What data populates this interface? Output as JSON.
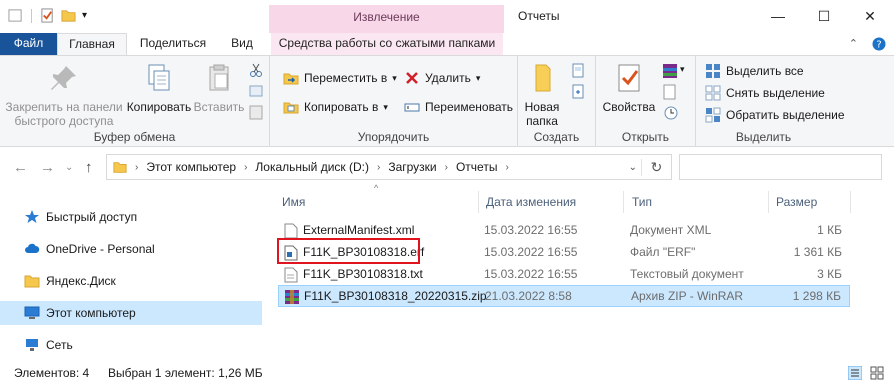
{
  "titlebar": {
    "context_tab_title": "Извлечение",
    "window_title": "Отчеты",
    "minimize": "—",
    "maximize": "☐",
    "close": "✕"
  },
  "tabs": {
    "file": "Файл",
    "home": "Главная",
    "share": "Поделиться",
    "view": "Вид",
    "context": "Средства работы со сжатыми папками"
  },
  "ribbon": {
    "clipboard": {
      "label": "Буфер обмена",
      "pin": "Закрепить на панели быстрого доступа",
      "copy": "Копировать",
      "paste": "Вставить"
    },
    "organize": {
      "label": "Упорядочить",
      "move": "Переместить в",
      "copy_to": "Копировать в",
      "delete": "Удалить",
      "rename": "Переименовать"
    },
    "create": {
      "label": "Создать",
      "new_folder": "Новая папка"
    },
    "open": {
      "label": "Открыть",
      "properties": "Свойства"
    },
    "select": {
      "label": "Выделить",
      "select_all": "Выделить все",
      "select_none": "Снять выделение",
      "invert": "Обратить выделение"
    }
  },
  "address": {
    "crumbs": [
      "Этот компьютер",
      "Локальный диск (D:)",
      "Загрузки",
      "Отчеты"
    ]
  },
  "navpane": {
    "items": [
      {
        "label": "Быстрый доступ",
        "icon": "star-icon"
      },
      {
        "label": "OneDrive - Personal",
        "icon": "cloud-icon"
      },
      {
        "label": "Яндекс.Диск",
        "icon": "folder-icon"
      },
      {
        "label": "Этот компьютер",
        "icon": "computer-icon",
        "selected": true
      },
      {
        "label": "Сеть",
        "icon": "network-icon"
      }
    ]
  },
  "columns": {
    "name": "Имя",
    "date": "Дата изменения",
    "type": "Тип",
    "size": "Размер"
  },
  "files": [
    {
      "name": "ExternalManifest.xml",
      "date": "15.03.2022 16:55",
      "type": "Документ XML",
      "size": "1 КБ",
      "icon": "xml-file-icon"
    },
    {
      "name": "F11K_BP30108318.erf",
      "date": "15.03.2022 16:55",
      "type": "Файл \"ERF\"",
      "size": "1 361 КБ",
      "icon": "erf-file-icon"
    },
    {
      "name": "F11K_BP30108318.txt",
      "date": "15.03.2022 16:55",
      "type": "Текстовый документ",
      "size": "3 КБ",
      "icon": "txt-file-icon"
    },
    {
      "name": "F11K_BP30108318_20220315.zip",
      "date": "21.03.2022 8:58",
      "type": "Архив ZIP - WinRAR",
      "size": "1 298 КБ",
      "icon": "winrar-archive-icon",
      "selected": true
    }
  ],
  "status": {
    "count": "Элементов: 4",
    "selection": "Выбран 1 элемент: 1,26 МБ"
  },
  "colors": {
    "accent": "#19549a",
    "selection": "#cce8ff",
    "highlight_box": "#e0141e",
    "context_tab": "#f7d7e8"
  }
}
